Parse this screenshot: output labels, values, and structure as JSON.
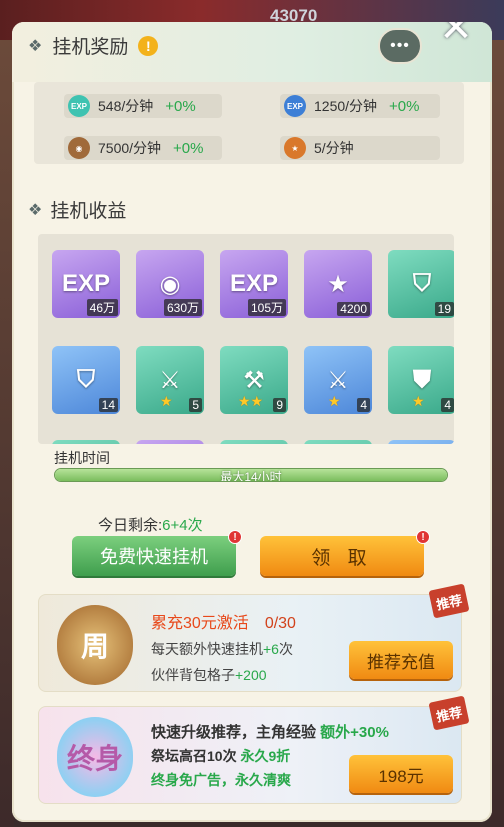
{
  "top": {
    "score": "43070"
  },
  "header": {
    "title": "挂机奖励",
    "info_glyph": "!",
    "chat_glyph": "•••",
    "close_glyph": "✕"
  },
  "rates": [
    {
      "icon": "exp-star-icon",
      "label": "548/分钟",
      "pct": "+0%",
      "color": "#3fc3b1"
    },
    {
      "icon": "exp-orb-icon",
      "label": "1250/分钟",
      "pct": "+0%",
      "color": "#3d7fd6"
    },
    {
      "icon": "coin-icon",
      "label": "7500/分钟",
      "pct": "+0%",
      "color": "#a06a3a"
    },
    {
      "icon": "star-medal-icon",
      "label": "5/分钟",
      "pct": "",
      "color": "#d9782b"
    }
  ],
  "section": {
    "title": "挂机收益"
  },
  "items": [
    {
      "name": "exp-star-item",
      "symbol": "EXP",
      "count": "46万",
      "stars": ""
    },
    {
      "name": "coin-item",
      "symbol": "◉",
      "count": "630万",
      "stars": ""
    },
    {
      "name": "exp-orb-item",
      "symbol": "EXP",
      "count": "105万",
      "stars": ""
    },
    {
      "name": "star-medal-item",
      "symbol": "★",
      "count": "4200",
      "stars": ""
    },
    {
      "name": "green-armor-item",
      "symbol": "⛉",
      "count": "19",
      "stars": ""
    },
    {
      "name": "blue-armor-item",
      "symbol": "⛉",
      "count": "14",
      "stars": ""
    },
    {
      "name": "blade-item",
      "symbol": "⚔",
      "count": "5",
      "stars": "★"
    },
    {
      "name": "hammer-item",
      "symbol": "⚒",
      "count": "9",
      "stars": "★★"
    },
    {
      "name": "sword-item",
      "symbol": "⚔",
      "count": "4",
      "stars": "★"
    },
    {
      "name": "robe-item",
      "symbol": "⛊",
      "count": "4",
      "stars": "★"
    }
  ],
  "idle": {
    "label": "挂机时间",
    "bar_text": "最大14小时",
    "progress": 1.0
  },
  "remain": {
    "prefix": "今日剩余:",
    "value": "6+4次"
  },
  "buttons": {
    "free": "免费快速挂机",
    "get": "领 取",
    "badge": "!"
  },
  "card1": {
    "emblem": "周",
    "title": "累充30元激活",
    "progress": "0/30",
    "line2_pre": "每天额外快速挂机",
    "line2_val": "+6",
    "line2_post": "次",
    "line3_pre": "伙伴背包格子",
    "line3_val": "+200",
    "button": "推荐充值",
    "tag": "推荐"
  },
  "card2": {
    "emblem": "终身",
    "line1_pre": "快速升级推荐，主角经验 ",
    "line1_val": "额外+30%",
    "line2_pre": "祭坛高召10次 ",
    "line2_val": "永久9折",
    "line3": "终身免广告，永久清爽",
    "button": "198元",
    "tag": "推荐"
  }
}
